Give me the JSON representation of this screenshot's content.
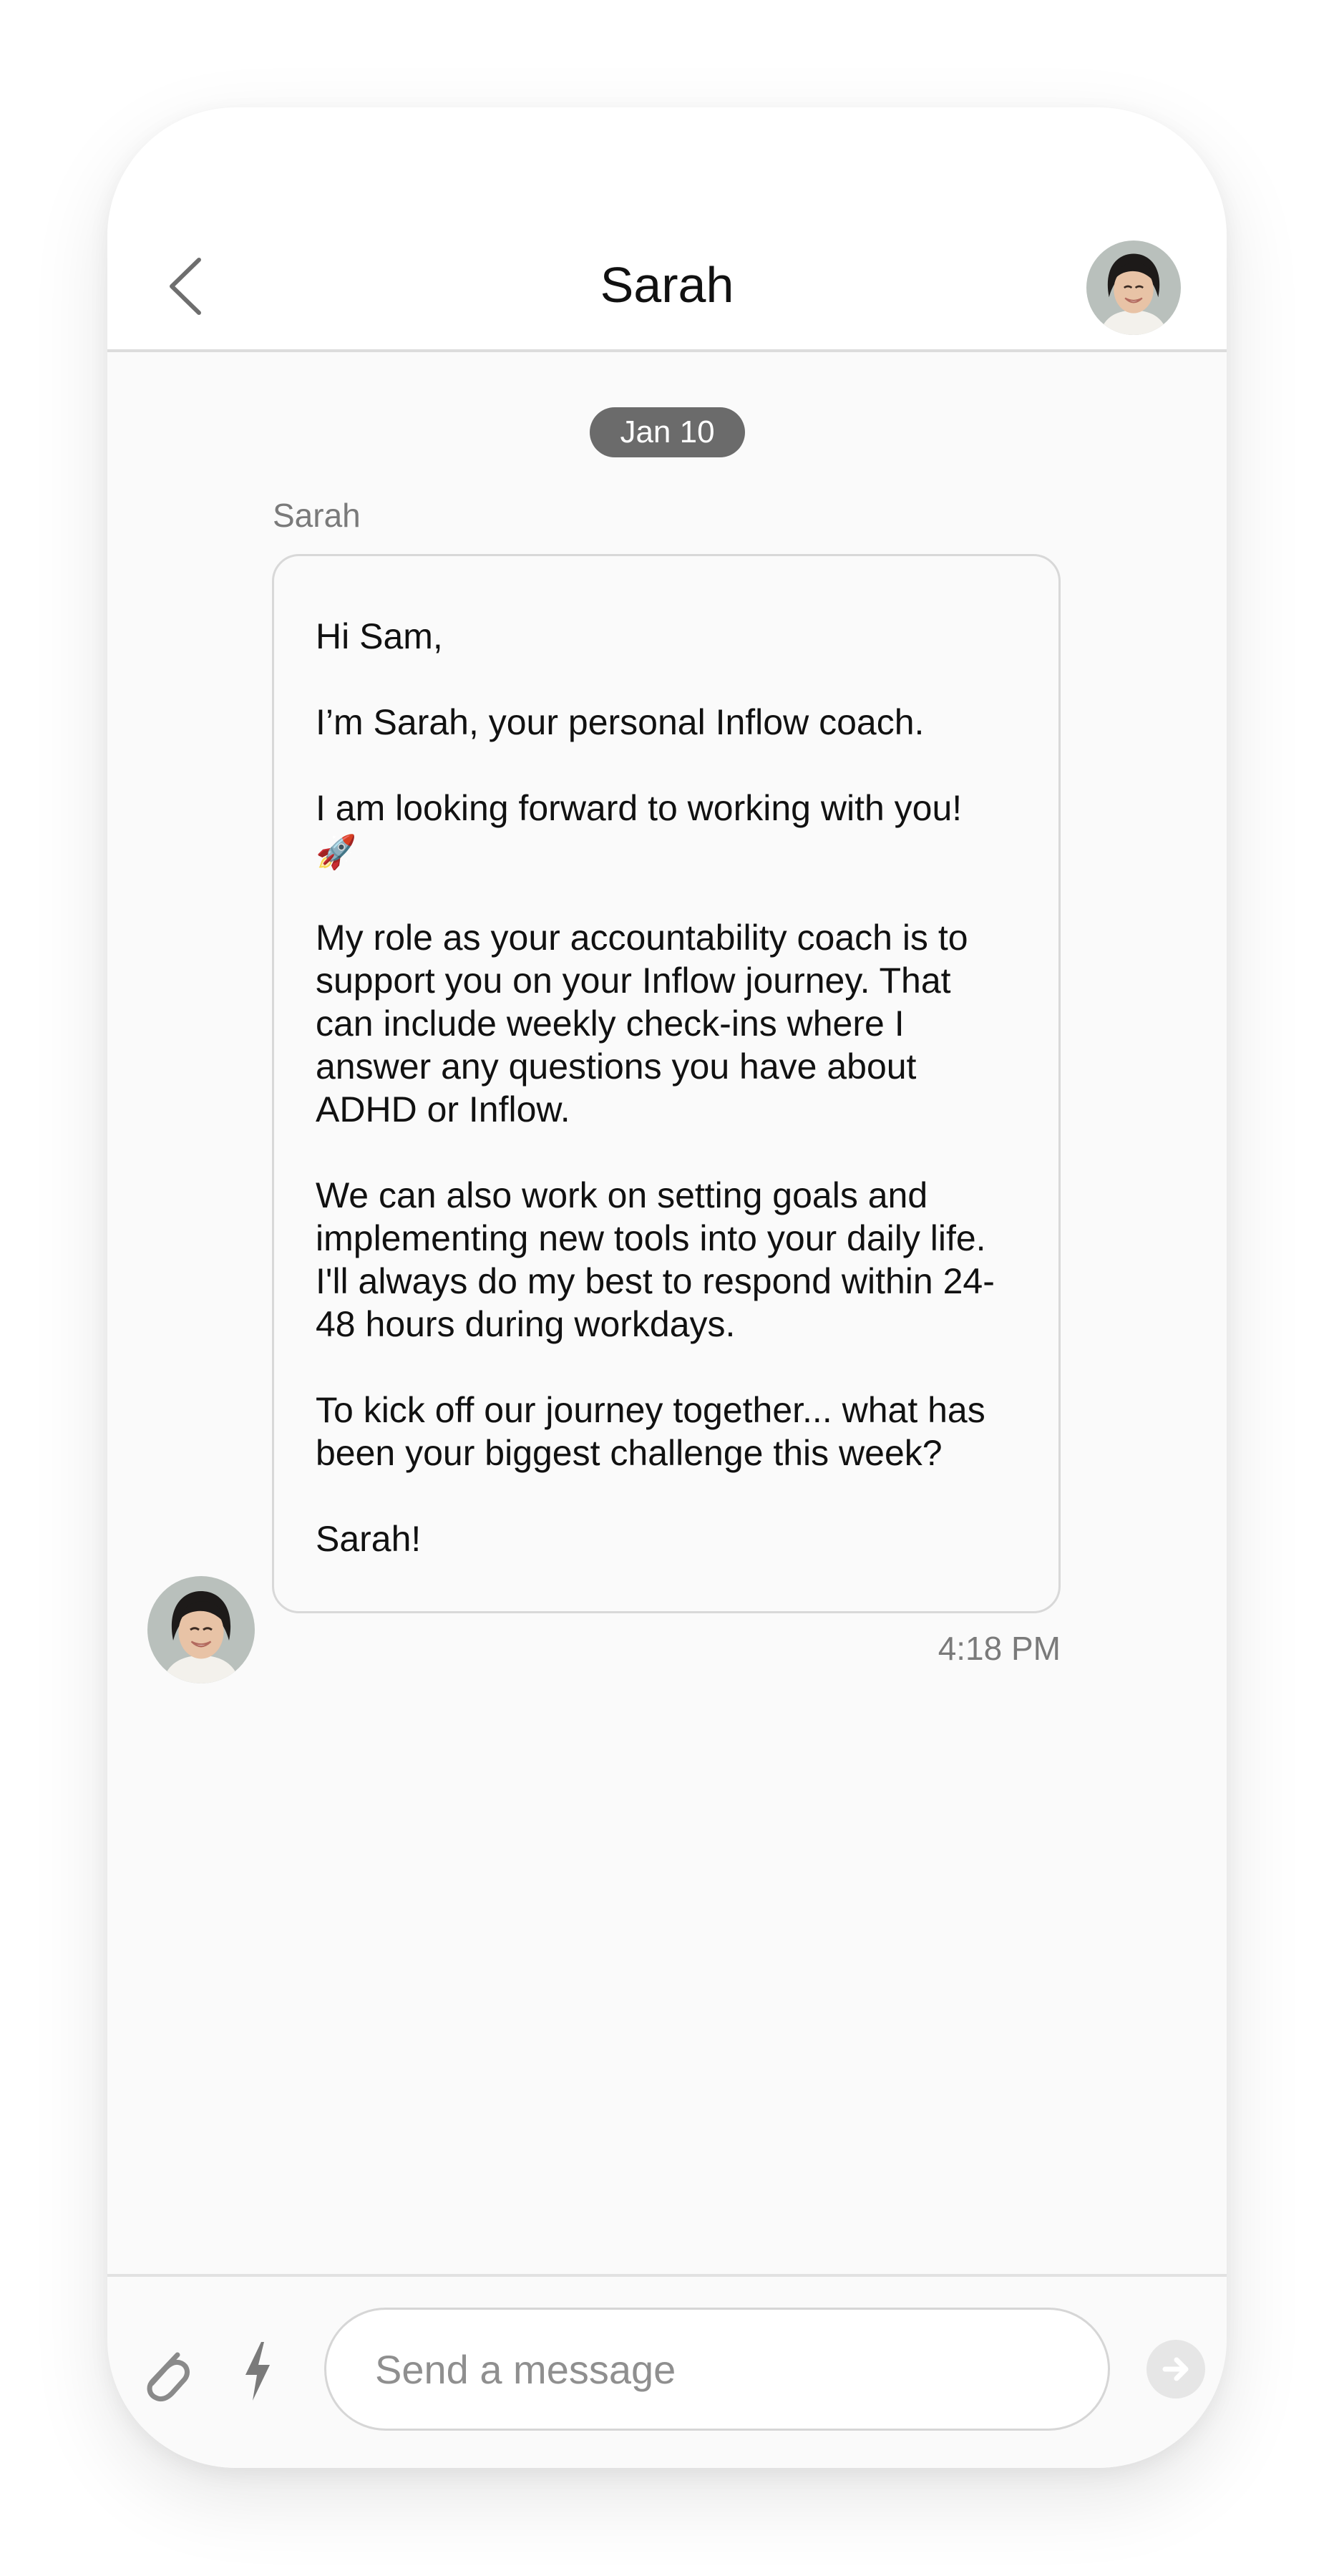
{
  "header": {
    "title": "Sarah",
    "back_icon": "chevron-left-icon",
    "avatar_icon": "avatar"
  },
  "conversation": {
    "date_label": "Jan 10",
    "messages": [
      {
        "sender": "Sarah",
        "time": "4:18 PM",
        "paragraphs": [
          "Hi Sam,",
          "I’m Sarah, your personal Inflow coach.",
          "I am looking forward to working with you!",
          "My role as your accountability coach is to support you on your Inflow journey. That can include weekly check-ins where I answer any questions you have about ADHD or Inflow.",
          "We can also work on setting goals and implementing new tools into your daily life. I'll always do my best to respond within 24-48 hours during workdays.",
          "To kick off our journey together... what has been your biggest challenge this week?",
          "Sarah!"
        ],
        "emoji": "🚀"
      }
    ]
  },
  "composer": {
    "placeholder": "Send a message",
    "value": "",
    "attach_icon": "paperclip-icon",
    "quick_icon": "lightning-icon",
    "send_icon": "arrow-right-icon"
  },
  "colors": {
    "background": "#fafafa",
    "date_pill": "#6b6b6b",
    "muted_text": "#7a7a7a",
    "border": "#d8d8d8"
  }
}
